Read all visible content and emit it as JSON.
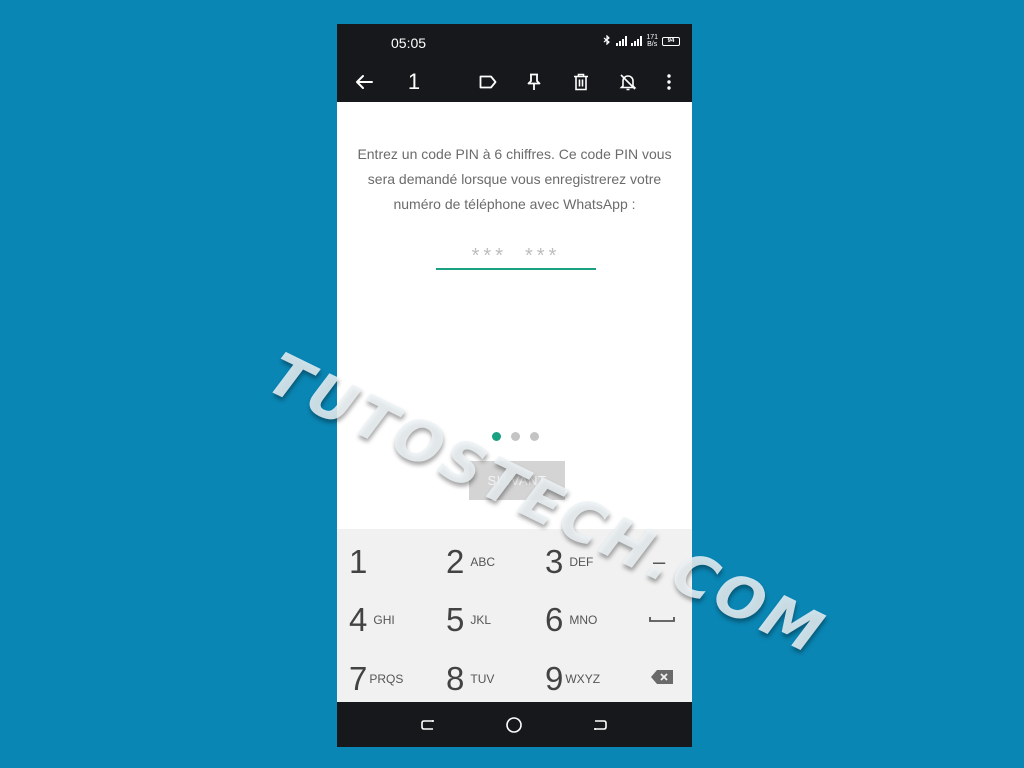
{
  "status_bar": {
    "time": "05:05",
    "speed_value": "171",
    "speed_unit": "B/s",
    "battery": "94"
  },
  "toolbar": {
    "selected_count": "1"
  },
  "setup": {
    "instructions": "Entrez un code PIN à 6 chiffres. Ce code PIN vous sera demandé lorsque vous enregistrerez votre numéro de téléphone avec WhatsApp :",
    "pin_placeholder_left": "***",
    "pin_placeholder_right": "***",
    "next_label": "SUIVANT",
    "step_current": 1,
    "step_total": 3
  },
  "keypad": {
    "keys": [
      {
        "num": "1",
        "letters": ""
      },
      {
        "num": "2",
        "letters": "ABC"
      },
      {
        "num": "3",
        "letters": "DEF"
      },
      {
        "num": "4",
        "letters": "GHI"
      },
      {
        "num": "5",
        "letters": "JKL"
      },
      {
        "num": "6",
        "letters": "MNO"
      },
      {
        "num": "7",
        "letters": "PRQS"
      },
      {
        "num": "8",
        "letters": "TUV"
      },
      {
        "num": "9",
        "letters": "WXYZ"
      }
    ],
    "minus": "–"
  },
  "watermark": {
    "text": "TUTOSTECH.COM"
  },
  "colors": {
    "background": "#0a86b4",
    "accent": "#1aa082",
    "bar": "#16181b"
  }
}
